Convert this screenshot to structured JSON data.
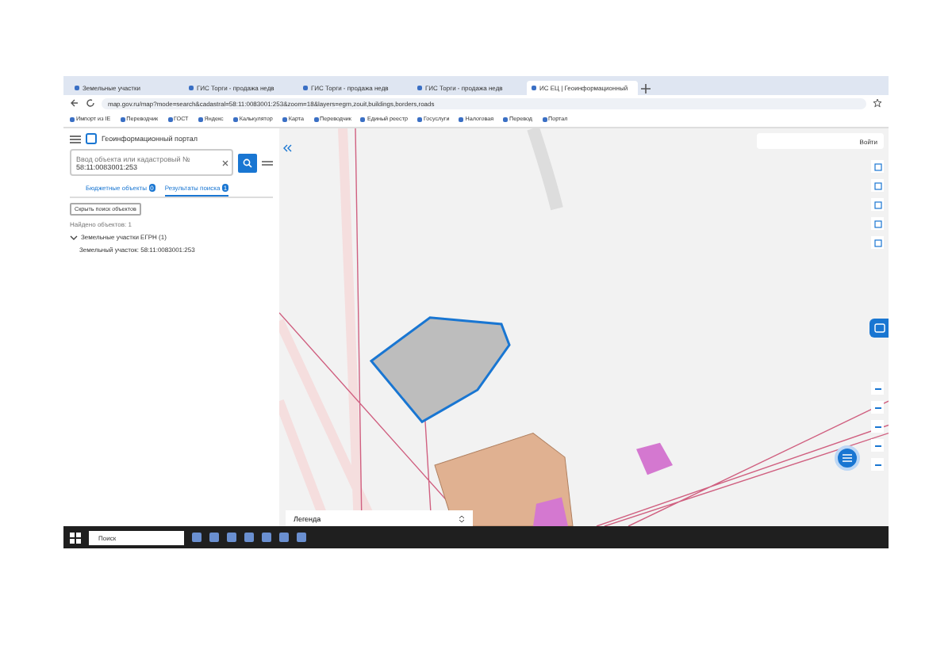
{
  "browser": {
    "tabs": [
      {
        "title": "Земельные участки",
        "selected": false
      },
      {
        "title": "ГИС Торги - продажа недв",
        "selected": false
      },
      {
        "title": "ГИС Торги - продажа недв",
        "selected": false
      },
      {
        "title": "ГИС Торги - продажа недв",
        "selected": false
      },
      {
        "title": "ИС ЕЦ | Геоинформационный",
        "selected": true
      }
    ],
    "url": "map.gov.ru/map?mode=search&cadastral=58:11:0083001:253&zoom=18&layers=egrn,zouit,buildings,borders,roads",
    "bookmarks": [
      "Импорт из IE",
      "Переводчик",
      "ГОСТ",
      "Яндекс",
      "Калькулятор",
      "Карта",
      "Переводчик",
      "Единый реестр",
      "Госуслуги",
      "Налоговая",
      "Перевод",
      "Портал"
    ]
  },
  "app": {
    "title": "Геоинформационный портал",
    "search": {
      "label": "Ввод объекта или кадастровый №",
      "value": "58:11:0083001:253"
    },
    "panel_tabs": [
      {
        "label": "Бюджетные объекты",
        "count": "0",
        "selected": false
      },
      {
        "label": "Результаты поиска",
        "count": "1",
        "selected": true
      }
    ],
    "hide_button": "Скрыть поиск объектов",
    "found": "Найдено объектов: 1",
    "group": {
      "label": "Земельные участки ЕГРН (1)",
      "expanded": true
    },
    "result": "Земельный участок: 58:11:0083001:253",
    "login": "Войти",
    "legend": "Легенда"
  },
  "taskbar": {
    "search": "Поиск"
  }
}
